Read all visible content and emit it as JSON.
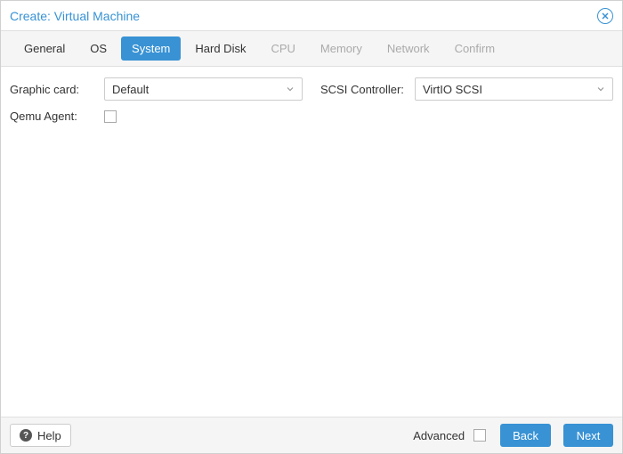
{
  "window": {
    "title": "Create: Virtual Machine"
  },
  "tabs": [
    {
      "label": "General",
      "state": "normal"
    },
    {
      "label": "OS",
      "state": "normal"
    },
    {
      "label": "System",
      "state": "active"
    },
    {
      "label": "Hard Disk",
      "state": "normal"
    },
    {
      "label": "CPU",
      "state": "disabled"
    },
    {
      "label": "Memory",
      "state": "disabled"
    },
    {
      "label": "Network",
      "state": "disabled"
    },
    {
      "label": "Confirm",
      "state": "disabled"
    }
  ],
  "form": {
    "graphic_card": {
      "label": "Graphic card:",
      "value": "Default"
    },
    "qemu_agent": {
      "label": "Qemu Agent:",
      "checked": false
    },
    "scsi_controller": {
      "label": "SCSI Controller:",
      "value": "VirtIO SCSI"
    }
  },
  "footer": {
    "help": "Help",
    "advanced": "Advanced",
    "advanced_checked": false,
    "back": "Back",
    "next": "Next"
  }
}
